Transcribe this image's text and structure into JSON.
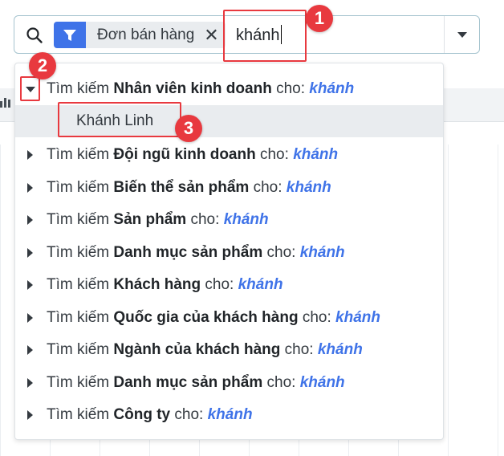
{
  "search": {
    "facet_label": "Đơn bán hàng",
    "facet_remove": "✕",
    "query": "khánh"
  },
  "dropdown": {
    "prefix": "Tìm kiếm",
    "mid": "cho:",
    "term": "khánh",
    "expanded": {
      "field": "Nhân viên kinh doanh",
      "result": "Khánh Linh"
    },
    "items": [
      {
        "field": "Đội ngũ kinh doanh"
      },
      {
        "field": "Biến thể sản phẩm"
      },
      {
        "field": "Sản phẩm"
      },
      {
        "field": "Danh mục sản phẩm"
      },
      {
        "field": "Khách hàng"
      },
      {
        "field": "Quốc gia của khách hàng"
      },
      {
        "field": "Ngành của khách hàng"
      },
      {
        "field": "Danh mục sản phẩm"
      },
      {
        "field": "Công ty"
      }
    ]
  },
  "annotations": [
    "1",
    "2",
    "3"
  ],
  "colors": {
    "accent": "#3f73e8",
    "annotation": "#e8393f",
    "highlight": "#e9ecef"
  },
  "icons": {
    "search": "search-icon",
    "filter": "filter-icon",
    "toggle": "caret-down-icon",
    "expand": "caret-right-icon"
  }
}
